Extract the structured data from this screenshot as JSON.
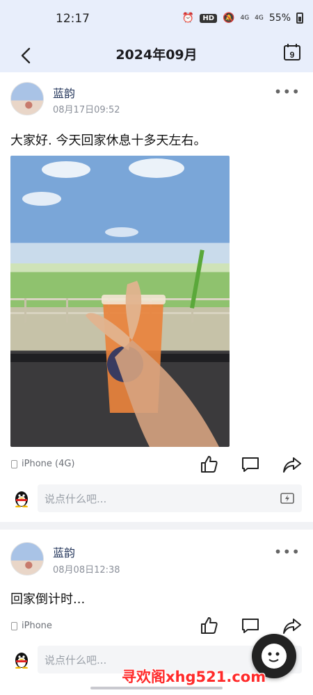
{
  "status_bar": {
    "time": "12:17",
    "hd": "HD",
    "network1": "4G",
    "network2": "4G",
    "battery": "55%"
  },
  "header": {
    "title": "2024年09月",
    "calendar_day": "9"
  },
  "posts": [
    {
      "author": "蓝韵",
      "time": "08月17日09:52",
      "text": "大家好. 今天回家休息十多天左右。",
      "device": "iPhone (4G)",
      "comment_placeholder": "说点什么吧..."
    },
    {
      "author": "蓝韵",
      "time": "08月08日12:38",
      "text": "回家倒计时...",
      "device": "iPhone",
      "comment_placeholder": "说点什么吧..."
    }
  ],
  "icons": {
    "back": "back-arrow-icon",
    "calendar": "calendar-icon",
    "more": "more-dots-icon",
    "like": "thumbs-up-icon",
    "comment": "comment-bubble-icon",
    "share": "share-arrow-icon",
    "qq": "qq-penguin-icon",
    "emoji": "emoji-keyboard-icon"
  },
  "watermark": "寻欢阁xhg521.com",
  "colors": {
    "header_bg": "#e8eefb",
    "author": "#22345a",
    "watermark": "#ff2a2a"
  }
}
